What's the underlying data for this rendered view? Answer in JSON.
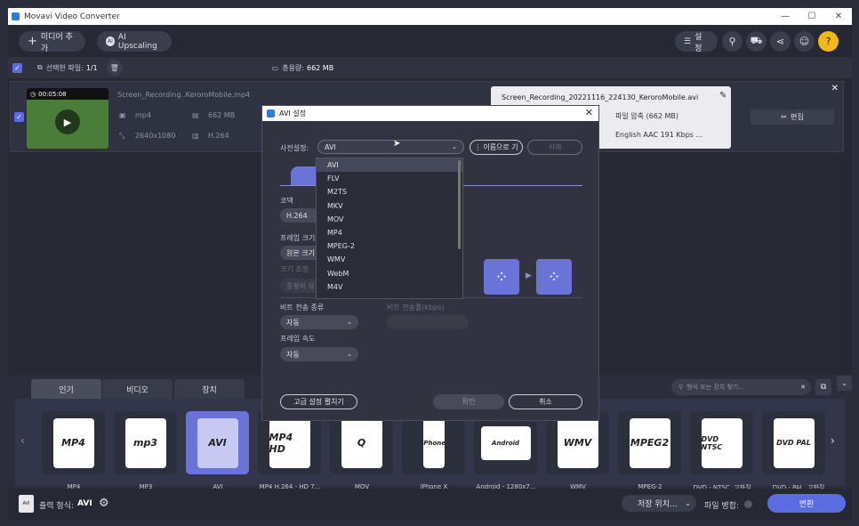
{
  "window": {
    "title": "Movavi Video Converter",
    "controls": [
      "—",
      "☐",
      "✕"
    ]
  },
  "toolbar": {
    "add_media": "미디어 추가",
    "ai_upscaling": "AI Upscaling",
    "settings": "설정"
  },
  "selection": {
    "selected_label": "선택한 파일:",
    "selected_count": "1/1",
    "total_label": "총용량:",
    "total_size": "662 MB"
  },
  "file": {
    "duration": "00:05:08",
    "name": "Screen_Recording..KeroroMobile.mp4",
    "format": "mp4",
    "size": "662 MB",
    "resolution": "2640x1080",
    "codec": "H.264",
    "output_name": "Screen_Recording_20221116_224130_KeroroMobile.avi",
    "compress": "파일 압축 (662 MB)",
    "audio": "English AAC 191 Kbps ...",
    "edit": "편집"
  },
  "dialog": {
    "title": "AVI 설정",
    "preset_label": "사전설정:",
    "preset_value": "AVI",
    "rename_button": "이름으로 기",
    "delete_button": "삭제",
    "codec_label": "코덱",
    "codec_value": "H.264",
    "frame_size_label": "프레임 크기",
    "frame_size_value": "원본 크기",
    "resize_label": "크기 조정",
    "resize_value": "종횡비 유",
    "bitrate_type_label": "비트 전송 종류",
    "bitrate_type_value": "자동",
    "bitrate_label": "비트 전송률(kbps)",
    "frame_rate_label": "프레임 속도",
    "frame_rate_value": "자동",
    "advanced_button": "고급 설정 펼치기",
    "ok_button": "확인",
    "cancel_button": "취소",
    "preset_options": [
      "AVI",
      "FLV",
      "M2TS",
      "MKV",
      "MOV",
      "MP4",
      "MPEG-2",
      "WMV",
      "WebM",
      "M4V"
    ]
  },
  "bottom": {
    "tabs": [
      "인기",
      "비디오",
      "장치"
    ],
    "search_placeholder": "형식 또는 장치 찾기...",
    "tiles": [
      {
        "icon": "MP4",
        "label": "MP4"
      },
      {
        "icon": "mp3",
        "label": "MP3"
      },
      {
        "icon": "AVI",
        "label": "AVI"
      },
      {
        "icon": "MP4 HD",
        "label": "MP4 H.264 - HD 7..."
      },
      {
        "icon": "Q",
        "label": "MOV"
      },
      {
        "icon": "iPhone",
        "label": "iPhone X"
      },
      {
        "icon": "Android",
        "label": "Android - 1280x7..."
      },
      {
        "icon": "WMV",
        "label": "WMV"
      },
      {
        "icon": "MPEG2",
        "label": "MPEG-2"
      },
      {
        "icon": "DVD NTSC",
        "label": "DVD - NTSC, 고화질"
      },
      {
        "icon": "DVD PAL",
        "label": "DVD - PAL, 고화질"
      }
    ]
  },
  "footer": {
    "output_label": "출력 형식:",
    "output_value": "AVI",
    "save_location": "저장 위치...",
    "merge_label": "파일 병합:",
    "convert": "변환"
  }
}
